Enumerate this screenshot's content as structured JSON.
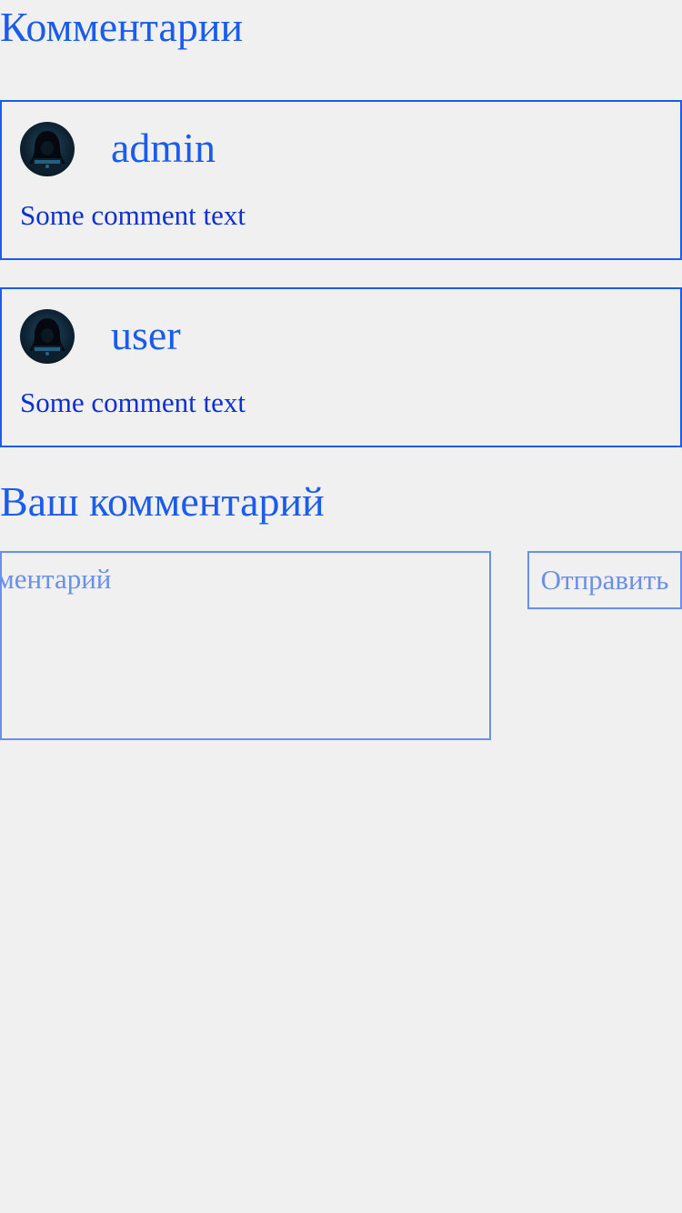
{
  "comments_section": {
    "title": "Комментарии"
  },
  "comments": [
    {
      "author": "admin",
      "text": "Some comment text",
      "avatar_icon": "hooded-figure-avatar-icon"
    },
    {
      "author": "user",
      "text": "Some comment text",
      "avatar_icon": "hooded-figure-avatar-icon"
    }
  ],
  "comment_form": {
    "title": "Ваш комментарий",
    "placeholder": "Ваш комментарий",
    "submit_label": "Отправить"
  },
  "colors": {
    "accent": "#1a5cf0",
    "text_dark": "#0d2fd8",
    "muted_border": "#6a90ee",
    "background": "#f0f0f0"
  }
}
